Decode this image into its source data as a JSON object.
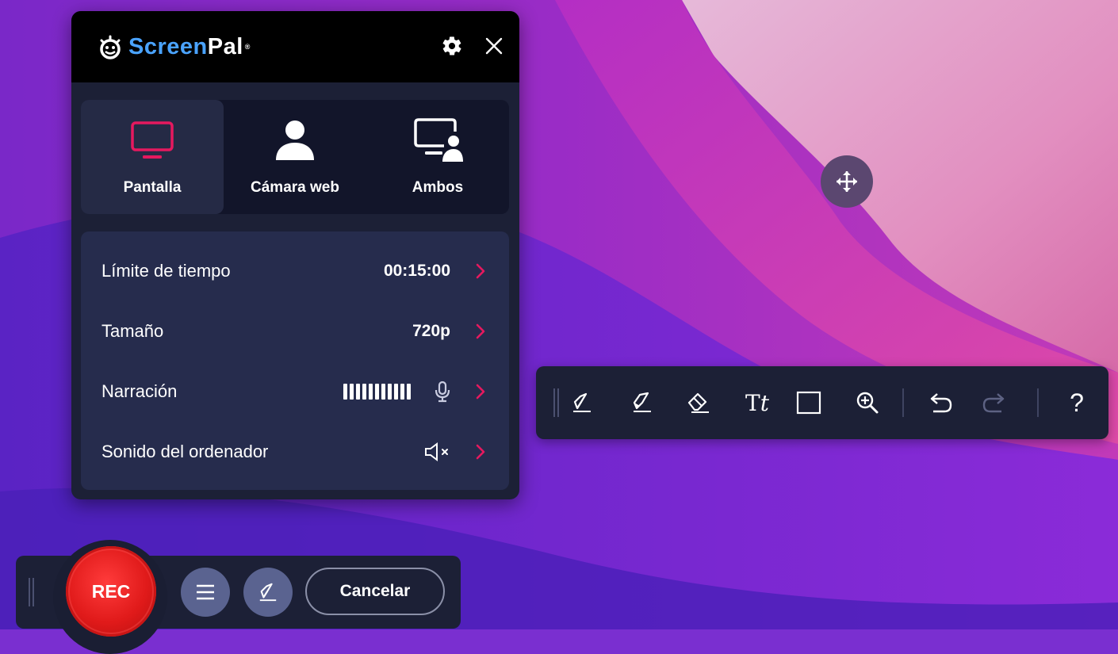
{
  "app": {
    "logo_word_1": "Screen",
    "logo_word_2": "Pal",
    "logo_registered": "®"
  },
  "header": {
    "settings_icon": "gear-icon",
    "close_icon": "close-icon"
  },
  "modes": [
    {
      "label": "Pantalla",
      "icon": "monitor-icon",
      "active": true
    },
    {
      "label": "Cámara web",
      "icon": "person-icon",
      "active": false
    },
    {
      "label": "Ambos",
      "icon": "monitor-person-icon",
      "active": false
    }
  ],
  "settings": {
    "time_limit": {
      "label": "Límite de tiempo",
      "value": "00:15:00"
    },
    "size": {
      "label": "Tamaño",
      "value": "720p"
    },
    "narration": {
      "label": "Narración",
      "icon": "microphone-icon"
    },
    "computer_sound": {
      "label": "Sonido del ordenador",
      "icon": "speaker-muted-icon"
    }
  },
  "draw_toolbar": {
    "tools": [
      "pen-icon",
      "highlighter-icon",
      "eraser-icon",
      "text-icon",
      "rectangle-icon",
      "zoom-icon",
      "undo-icon",
      "redo-icon",
      "help-icon"
    ],
    "text_tool_label": "Tt",
    "help_label": "?"
  },
  "bottom_bar": {
    "rec_label": "REC",
    "cancel_label": "Cancelar"
  },
  "colors": {
    "accent": "#e5195f",
    "panel": "#1c2036",
    "rec": "#e01a1a"
  }
}
